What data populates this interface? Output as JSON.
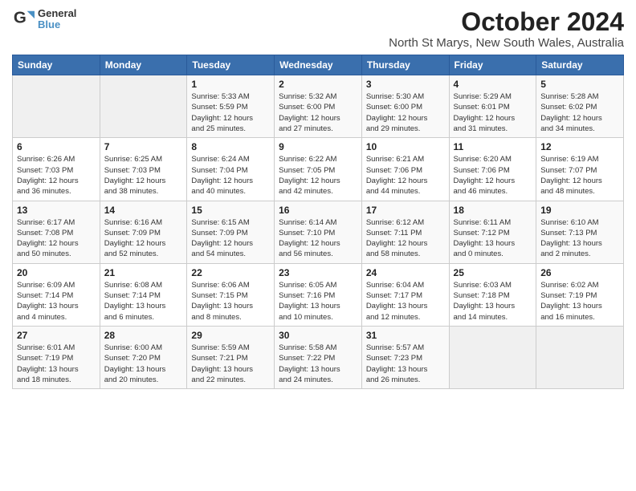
{
  "header": {
    "logo_line1": "General",
    "logo_line2": "Blue",
    "month": "October 2024",
    "location": "North St Marys, New South Wales, Australia"
  },
  "weekdays": [
    "Sunday",
    "Monday",
    "Tuesday",
    "Wednesday",
    "Thursday",
    "Friday",
    "Saturday"
  ],
  "weeks": [
    [
      {
        "day": "",
        "empty": true
      },
      {
        "day": "",
        "empty": true
      },
      {
        "day": "1",
        "info": "Sunrise: 5:33 AM\nSunset: 5:59 PM\nDaylight: 12 hours\nand 25 minutes."
      },
      {
        "day": "2",
        "info": "Sunrise: 5:32 AM\nSunset: 6:00 PM\nDaylight: 12 hours\nand 27 minutes."
      },
      {
        "day": "3",
        "info": "Sunrise: 5:30 AM\nSunset: 6:00 PM\nDaylight: 12 hours\nand 29 minutes."
      },
      {
        "day": "4",
        "info": "Sunrise: 5:29 AM\nSunset: 6:01 PM\nDaylight: 12 hours\nand 31 minutes."
      },
      {
        "day": "5",
        "info": "Sunrise: 5:28 AM\nSunset: 6:02 PM\nDaylight: 12 hours\nand 34 minutes."
      }
    ],
    [
      {
        "day": "6",
        "info": "Sunrise: 6:26 AM\nSunset: 7:03 PM\nDaylight: 12 hours\nand 36 minutes."
      },
      {
        "day": "7",
        "info": "Sunrise: 6:25 AM\nSunset: 7:03 PM\nDaylight: 12 hours\nand 38 minutes."
      },
      {
        "day": "8",
        "info": "Sunrise: 6:24 AM\nSunset: 7:04 PM\nDaylight: 12 hours\nand 40 minutes."
      },
      {
        "day": "9",
        "info": "Sunrise: 6:22 AM\nSunset: 7:05 PM\nDaylight: 12 hours\nand 42 minutes."
      },
      {
        "day": "10",
        "info": "Sunrise: 6:21 AM\nSunset: 7:06 PM\nDaylight: 12 hours\nand 44 minutes."
      },
      {
        "day": "11",
        "info": "Sunrise: 6:20 AM\nSunset: 7:06 PM\nDaylight: 12 hours\nand 46 minutes."
      },
      {
        "day": "12",
        "info": "Sunrise: 6:19 AM\nSunset: 7:07 PM\nDaylight: 12 hours\nand 48 minutes."
      }
    ],
    [
      {
        "day": "13",
        "info": "Sunrise: 6:17 AM\nSunset: 7:08 PM\nDaylight: 12 hours\nand 50 minutes."
      },
      {
        "day": "14",
        "info": "Sunrise: 6:16 AM\nSunset: 7:09 PM\nDaylight: 12 hours\nand 52 minutes."
      },
      {
        "day": "15",
        "info": "Sunrise: 6:15 AM\nSunset: 7:09 PM\nDaylight: 12 hours\nand 54 minutes."
      },
      {
        "day": "16",
        "info": "Sunrise: 6:14 AM\nSunset: 7:10 PM\nDaylight: 12 hours\nand 56 minutes."
      },
      {
        "day": "17",
        "info": "Sunrise: 6:12 AM\nSunset: 7:11 PM\nDaylight: 12 hours\nand 58 minutes."
      },
      {
        "day": "18",
        "info": "Sunrise: 6:11 AM\nSunset: 7:12 PM\nDaylight: 13 hours\nand 0 minutes."
      },
      {
        "day": "19",
        "info": "Sunrise: 6:10 AM\nSunset: 7:13 PM\nDaylight: 13 hours\nand 2 minutes."
      }
    ],
    [
      {
        "day": "20",
        "info": "Sunrise: 6:09 AM\nSunset: 7:14 PM\nDaylight: 13 hours\nand 4 minutes."
      },
      {
        "day": "21",
        "info": "Sunrise: 6:08 AM\nSunset: 7:14 PM\nDaylight: 13 hours\nand 6 minutes."
      },
      {
        "day": "22",
        "info": "Sunrise: 6:06 AM\nSunset: 7:15 PM\nDaylight: 13 hours\nand 8 minutes."
      },
      {
        "day": "23",
        "info": "Sunrise: 6:05 AM\nSunset: 7:16 PM\nDaylight: 13 hours\nand 10 minutes."
      },
      {
        "day": "24",
        "info": "Sunrise: 6:04 AM\nSunset: 7:17 PM\nDaylight: 13 hours\nand 12 minutes."
      },
      {
        "day": "25",
        "info": "Sunrise: 6:03 AM\nSunset: 7:18 PM\nDaylight: 13 hours\nand 14 minutes."
      },
      {
        "day": "26",
        "info": "Sunrise: 6:02 AM\nSunset: 7:19 PM\nDaylight: 13 hours\nand 16 minutes."
      }
    ],
    [
      {
        "day": "27",
        "info": "Sunrise: 6:01 AM\nSunset: 7:19 PM\nDaylight: 13 hours\nand 18 minutes."
      },
      {
        "day": "28",
        "info": "Sunrise: 6:00 AM\nSunset: 7:20 PM\nDaylight: 13 hours\nand 20 minutes."
      },
      {
        "day": "29",
        "info": "Sunrise: 5:59 AM\nSunset: 7:21 PM\nDaylight: 13 hours\nand 22 minutes."
      },
      {
        "day": "30",
        "info": "Sunrise: 5:58 AM\nSunset: 7:22 PM\nDaylight: 13 hours\nand 24 minutes."
      },
      {
        "day": "31",
        "info": "Sunrise: 5:57 AM\nSunset: 7:23 PM\nDaylight: 13 hours\nand 26 minutes."
      },
      {
        "day": "",
        "empty": true
      },
      {
        "day": "",
        "empty": true
      }
    ]
  ]
}
